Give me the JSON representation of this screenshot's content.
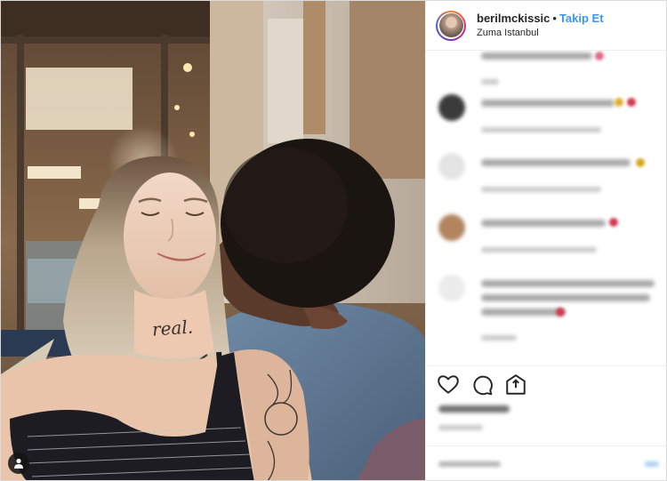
{
  "post": {
    "username": "berilmckissic",
    "separator": "•",
    "follow_label": "Takip Et",
    "location": "Zuma Istanbul"
  },
  "photo": {
    "neck_tattoo_text": "real."
  },
  "colors": {
    "follow_blue": "#3897f0",
    "border": "#efefef",
    "text": "#262626"
  },
  "icons": {
    "like": "heart-icon",
    "comment": "comment-icon",
    "share": "share-icon",
    "tag": "user-tag-icon"
  }
}
